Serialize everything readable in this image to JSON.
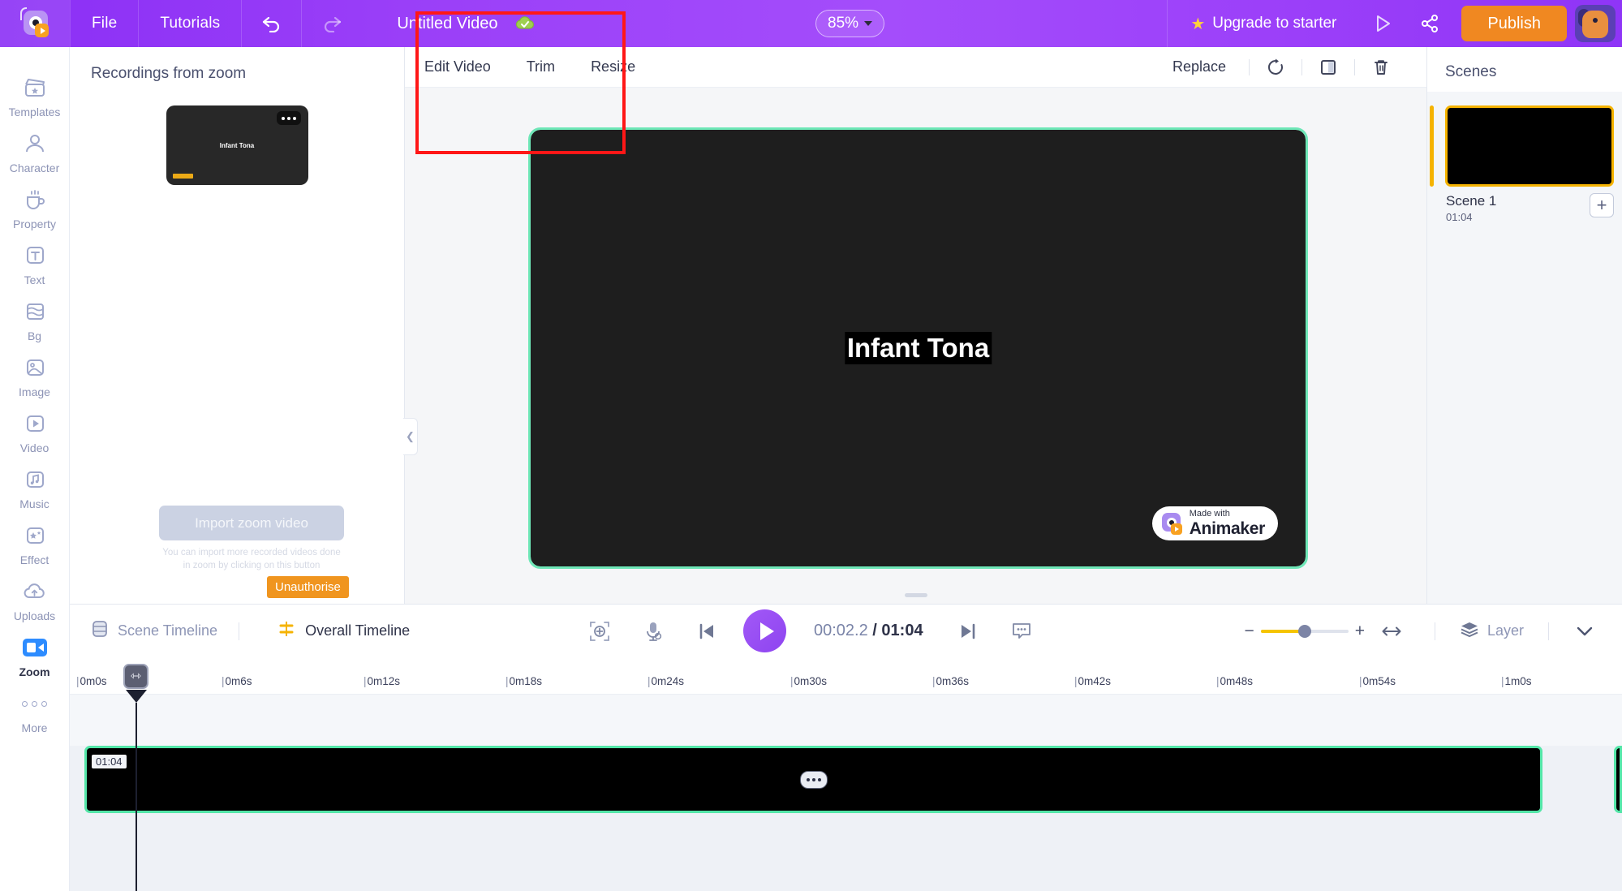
{
  "topbar": {
    "logo_name": "animaker-logo",
    "menu": [
      {
        "label": "File",
        "name": "menu-file"
      },
      {
        "label": "Tutorials",
        "name": "menu-tutorials"
      }
    ],
    "undo_icon": "undo-icon",
    "redo_icon": "redo-icon",
    "doc_title": "Untitled Video",
    "saved_icon": "cloud-saved-icon",
    "zoom_level": "85%",
    "upgrade_label": "Upgrade to starter",
    "star_icon": "star-icon",
    "preview_icon": "preview-play-icon",
    "share_icon": "share-icon",
    "publish_label": "Publish",
    "avatar_name": "user-avatar"
  },
  "rail": {
    "items": [
      {
        "label": "Templates",
        "icon": "templates-icon",
        "active": false
      },
      {
        "label": "Character",
        "icon": "character-icon",
        "active": false
      },
      {
        "label": "Property",
        "icon": "property-icon",
        "active": false
      },
      {
        "label": "Text",
        "icon": "text-icon",
        "active": false
      },
      {
        "label": "Bg",
        "icon": "background-icon",
        "active": false
      },
      {
        "label": "Image",
        "icon": "image-icon",
        "active": false
      },
      {
        "label": "Video",
        "icon": "video-icon",
        "active": false
      },
      {
        "label": "Music",
        "icon": "music-icon",
        "active": false
      },
      {
        "label": "Effect",
        "icon": "effect-icon",
        "active": false
      },
      {
        "label": "Uploads",
        "icon": "uploads-cloud-icon",
        "active": false
      },
      {
        "label": "Zoom",
        "icon": "zoom-app-icon",
        "active": true
      },
      {
        "label": "More",
        "icon": "more-dots-icon",
        "active": false
      }
    ]
  },
  "panel": {
    "title": "Recordings from zoom",
    "thumbnail_text": "Infant Tona",
    "thumbnail_menu_icon": "more-options-icon",
    "import_label": "Import zoom video",
    "import_hint": "You can import more recorded videos done in zoom by clicking on this button",
    "unauthorise_label": "Unauthorise",
    "collapse_icon": "chevron-left-icon"
  },
  "stage": {
    "tabs": [
      {
        "label": "Edit Video",
        "name": "tab-edit-video"
      },
      {
        "label": "Trim",
        "name": "tab-trim"
      },
      {
        "label": "Resize",
        "name": "tab-resize"
      }
    ],
    "replace_label": "Replace",
    "rotate_icon": "rotate-icon",
    "flip_icon": "flip-icon",
    "delete_icon": "trash-icon",
    "canvas_text": "Infant Tona",
    "watermark_small": "Made with",
    "watermark_big": "Animaker"
  },
  "scenes": {
    "title": "Scenes",
    "items": [
      {
        "name": "Scene 1",
        "duration": "01:04"
      }
    ],
    "add_label": "+"
  },
  "timeline": {
    "scene_timeline_label": "Scene Timeline",
    "overall_timeline_label": "Overall Timeline",
    "fit_icon": "fit-to-screen-icon",
    "mic_icon": "microphone-icon",
    "prev_icon": "skip-previous-icon",
    "play_icon": "play-icon",
    "next_icon": "skip-next-icon",
    "caption_icon": "caption-icon",
    "current_time": "00:02.2",
    "separator": "/",
    "total_time": "01:04",
    "zoom_minus": "−",
    "zoom_plus": "+",
    "fit_width_icon": "fit-width-icon",
    "layer_label": "Layer",
    "expand_icon": "chevron-down-icon",
    "ruler_ticks": [
      "0m0s",
      "0m6s",
      "0m12s",
      "0m18s",
      "0m24s",
      "0m30s",
      "0m36s",
      "0m42s",
      "0m48s",
      "0m54s",
      "1m0s"
    ],
    "clip_duration": "01:04",
    "clip_menu_icon": "clip-options-icon",
    "playhead_icon": "playhead-handle-icon"
  },
  "annotation": {
    "name": "red-highlight-box",
    "color": "#ff1717"
  },
  "colors": {
    "brand_purple": "#9a3ff8",
    "accent_orange": "#f08821",
    "accent_yellow": "#f5b301",
    "selection_green": "#54e6a8",
    "zoom_blue": "#2d8cff"
  }
}
